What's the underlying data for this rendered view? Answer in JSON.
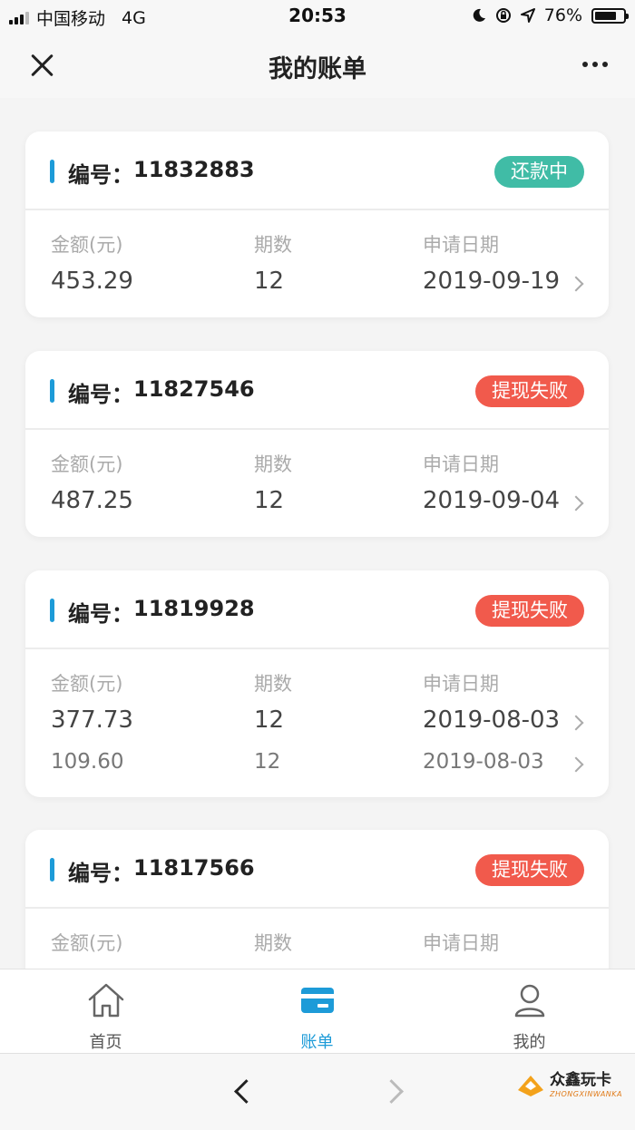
{
  "status_bar": {
    "carrier": "中国移动",
    "network": "4G",
    "time": "20:53",
    "battery": "76%",
    "battery_level": 0.76
  },
  "nav": {
    "title": "我的账单"
  },
  "labels": {
    "id_prefix": "编号：",
    "amount": "金额(元)",
    "periods": "期数",
    "apply_date": "申请日期"
  },
  "bills": [
    {
      "id": "11832883",
      "status": "还款中",
      "status_color": "#40bca6",
      "rows": [
        {
          "amount": "453.29",
          "periods": "12",
          "date": "2019-09-19"
        }
      ]
    },
    {
      "id": "11827546",
      "status": "提现失败",
      "status_color": "#f15a4c",
      "rows": [
        {
          "amount": "487.25",
          "periods": "12",
          "date": "2019-09-04"
        }
      ]
    },
    {
      "id": "11819928",
      "status": "提现失败",
      "status_color": "#f15a4c",
      "rows": [
        {
          "amount": "377.73",
          "periods": "12",
          "date": "2019-08-03"
        },
        {
          "amount": "109.60",
          "periods": "12",
          "date": "2019-08-03"
        }
      ]
    },
    {
      "id": "11817566",
      "status": "提现失败",
      "status_color": "#f15a4c",
      "rows": []
    }
  ],
  "tabs": [
    {
      "label": "首页",
      "icon": "home-icon"
    },
    {
      "label": "账单",
      "icon": "card-icon",
      "active": true
    },
    {
      "label": "我的",
      "icon": "user-icon"
    }
  ],
  "watermark": {
    "name": "众鑫玩卡",
    "sub": "ZHONGXINWANKA"
  },
  "colors": {
    "accent": "#1d9bd8",
    "teal": "#40bca6",
    "red": "#f15a4c"
  }
}
